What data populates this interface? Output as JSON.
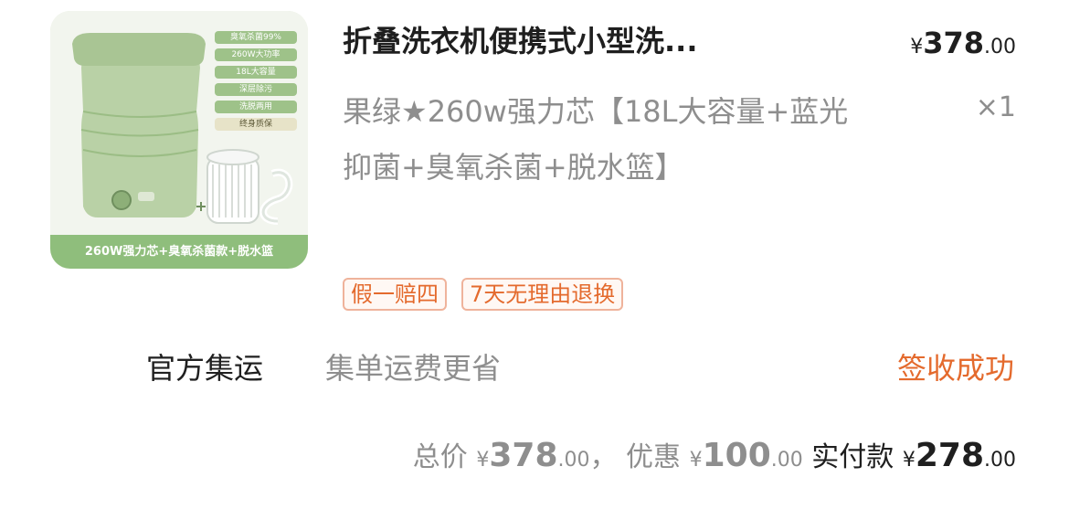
{
  "product": {
    "image_caption": "260W强力芯+臭氧杀菌款+脱水篮",
    "feature_tags": [
      "臭氧杀菌99%",
      "260W大功率",
      "18L大容量",
      "深层除污",
      "洗脱两用",
      "终身质保"
    ],
    "title": "折叠洗衣机便携式小型洗...",
    "price": {
      "symbol": "¥",
      "integer": "378",
      "decimal": ".00"
    },
    "quantity": "×1",
    "spec": "果绿★260w强力芯【18L大容量+蓝光抑菌+臭氧杀菌+脱水篮】",
    "service_tags": [
      "假一赔四",
      "7天无理由退换"
    ]
  },
  "shipping": {
    "label": "官方集运",
    "subtext": "集单运费更省",
    "status": "签收成功"
  },
  "summary": {
    "total_label": "总价",
    "total_symbol": "¥",
    "total_integer": "378",
    "total_decimal": ".00",
    "separator": "，",
    "discount_label": "优惠",
    "discount_symbol": "¥",
    "discount_integer": "100",
    "discount_decimal": ".00",
    "paid_label": "实付款",
    "paid_symbol": "¥",
    "paid_integer": "278",
    "paid_decimal": ".00"
  }
}
